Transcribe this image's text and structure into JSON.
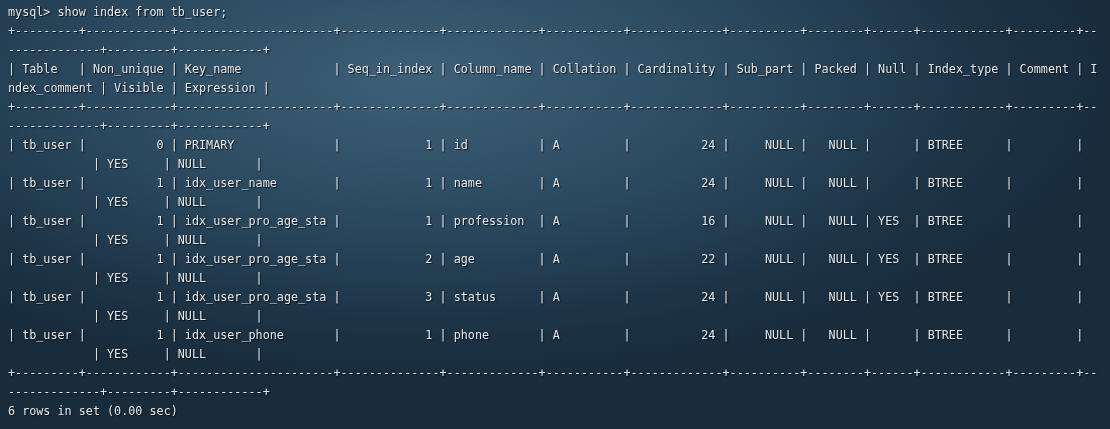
{
  "terminal": {
    "command": "mysql> show index from tb_user;",
    "output_lines": [
      "+---------+------------+----------------------+--------------+-------------+-----------+-------------+----------+--------+------+------------+---------+--",
      "-------------+---------+------------+",
      "| Table   | Non_unique | Key_name             | Seq_in_index | Column_name | Collation | Cardinality | Sub_part | Packed | Null | Index_type | Comment | I",
      "ndex_comment | Visible | Expression |",
      "+---------+------------+----------------------+--------------+-------------+-----------+-------------+----------+--------+------+------------+---------+--",
      "-------------+---------+------------+",
      "| tb_user |          0 | PRIMARY              |            1 | id          | A         |          24 |     NULL |   NULL |      | BTREE      |         |",
      "            | YES     | NULL       |",
      "| tb_user |          1 | idx_user_name        |            1 | name        | A         |          24 |     NULL |   NULL |      | BTREE      |         |",
      "            | YES     | NULL       |",
      "| tb_user |          1 | idx_user_pro_age_sta |            1 | profession  | A         |          16 |     NULL |   NULL | YES  | BTREE      |         |",
      "            | YES     | NULL       |",
      "| tb_user |          1 | idx_user_pro_age_sta |            2 | age         | A         |          22 |     NULL |   NULL | YES  | BTREE      |         |",
      "            | YES     | NULL       |",
      "| tb_user |          1 | idx_user_pro_age_sta |            3 | status      | A         |          24 |     NULL |   NULL | YES  | BTREE      |         |",
      "            | YES     | NULL       |",
      "| tb_user |          1 | idx_user_phone       |            1 | phone       | A         |          24 |     NULL |   NULL |      | BTREE      |         |",
      "            | YES     | NULL       |",
      "+---------+------------+----------------------+--------------+-------------+-----------+-------------+----------+--------+------+------------+---------+--",
      "-------------+---------+------------+"
    ],
    "status": "6 rows in set (0.00 sec)"
  }
}
